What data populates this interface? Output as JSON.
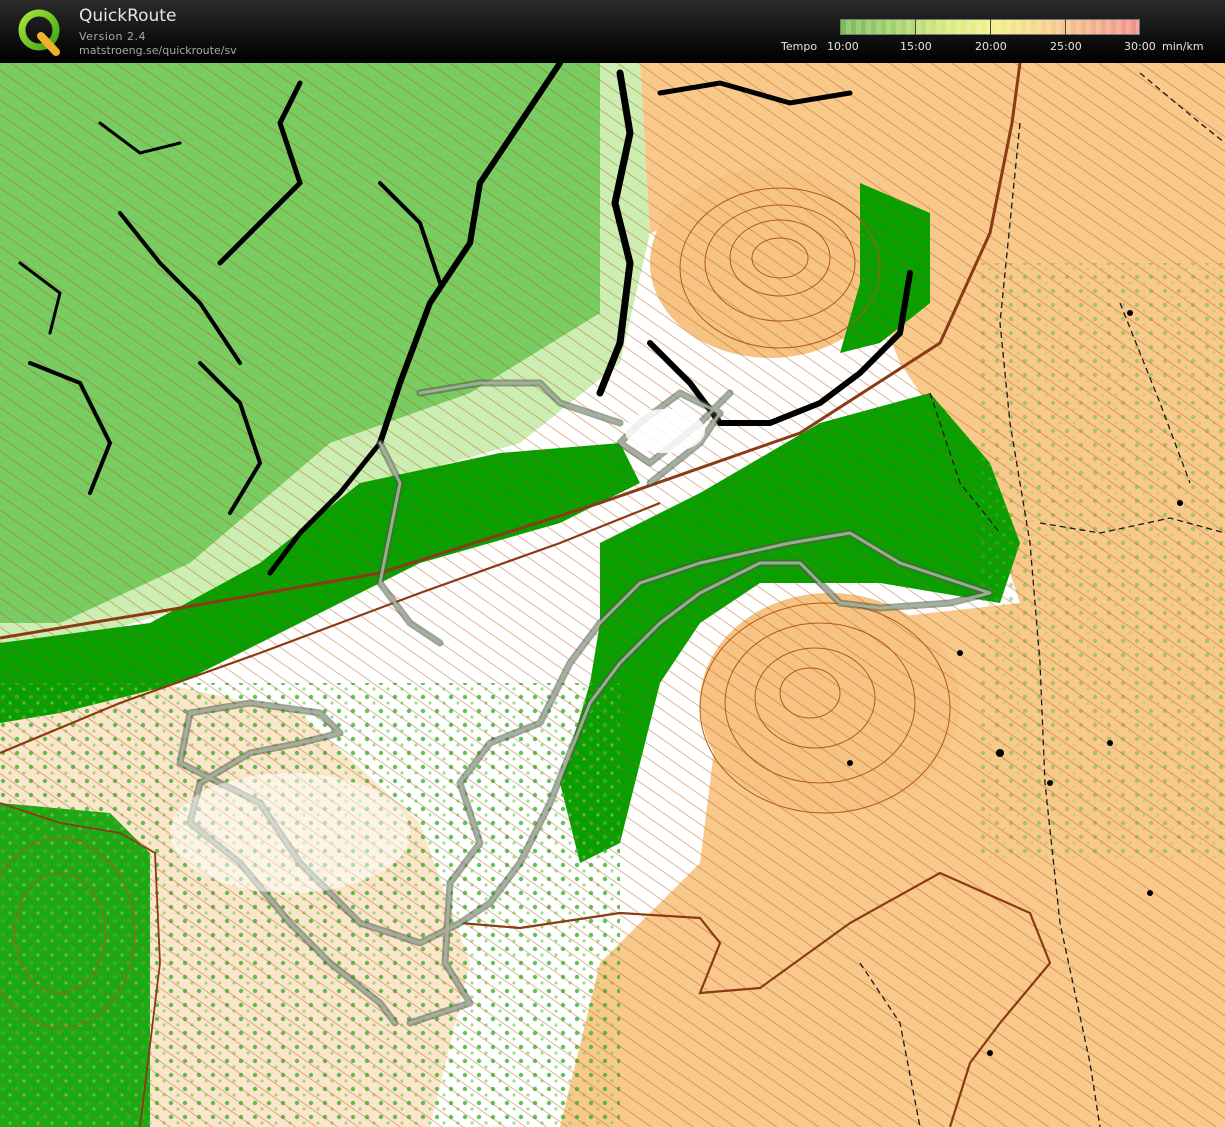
{
  "app": {
    "title": "QuickRoute",
    "version": "Version 2.4",
    "url": "matstroeng.se/quickroute/sv"
  },
  "pace_scale": {
    "label": "Tempo",
    "ticks": [
      "10:00",
      "15:00",
      "20:00",
      "25:00",
      "30:00"
    ],
    "unit": "min/km",
    "colors": [
      "#79bc5a",
      "#a7d36d",
      "#f3f08a",
      "#f6d98b",
      "#f0918a"
    ]
  },
  "map": {
    "colors": {
      "open_land": "#f8c98b",
      "forest_white": "#ffffff",
      "light_green": "#c4eba6",
      "medium_green": "#5cc046",
      "dark_green": "#08a000",
      "cliff": "#000000",
      "contour": "#b15a16",
      "road": "#8a3a15",
      "route": "#707a6c"
    }
  }
}
